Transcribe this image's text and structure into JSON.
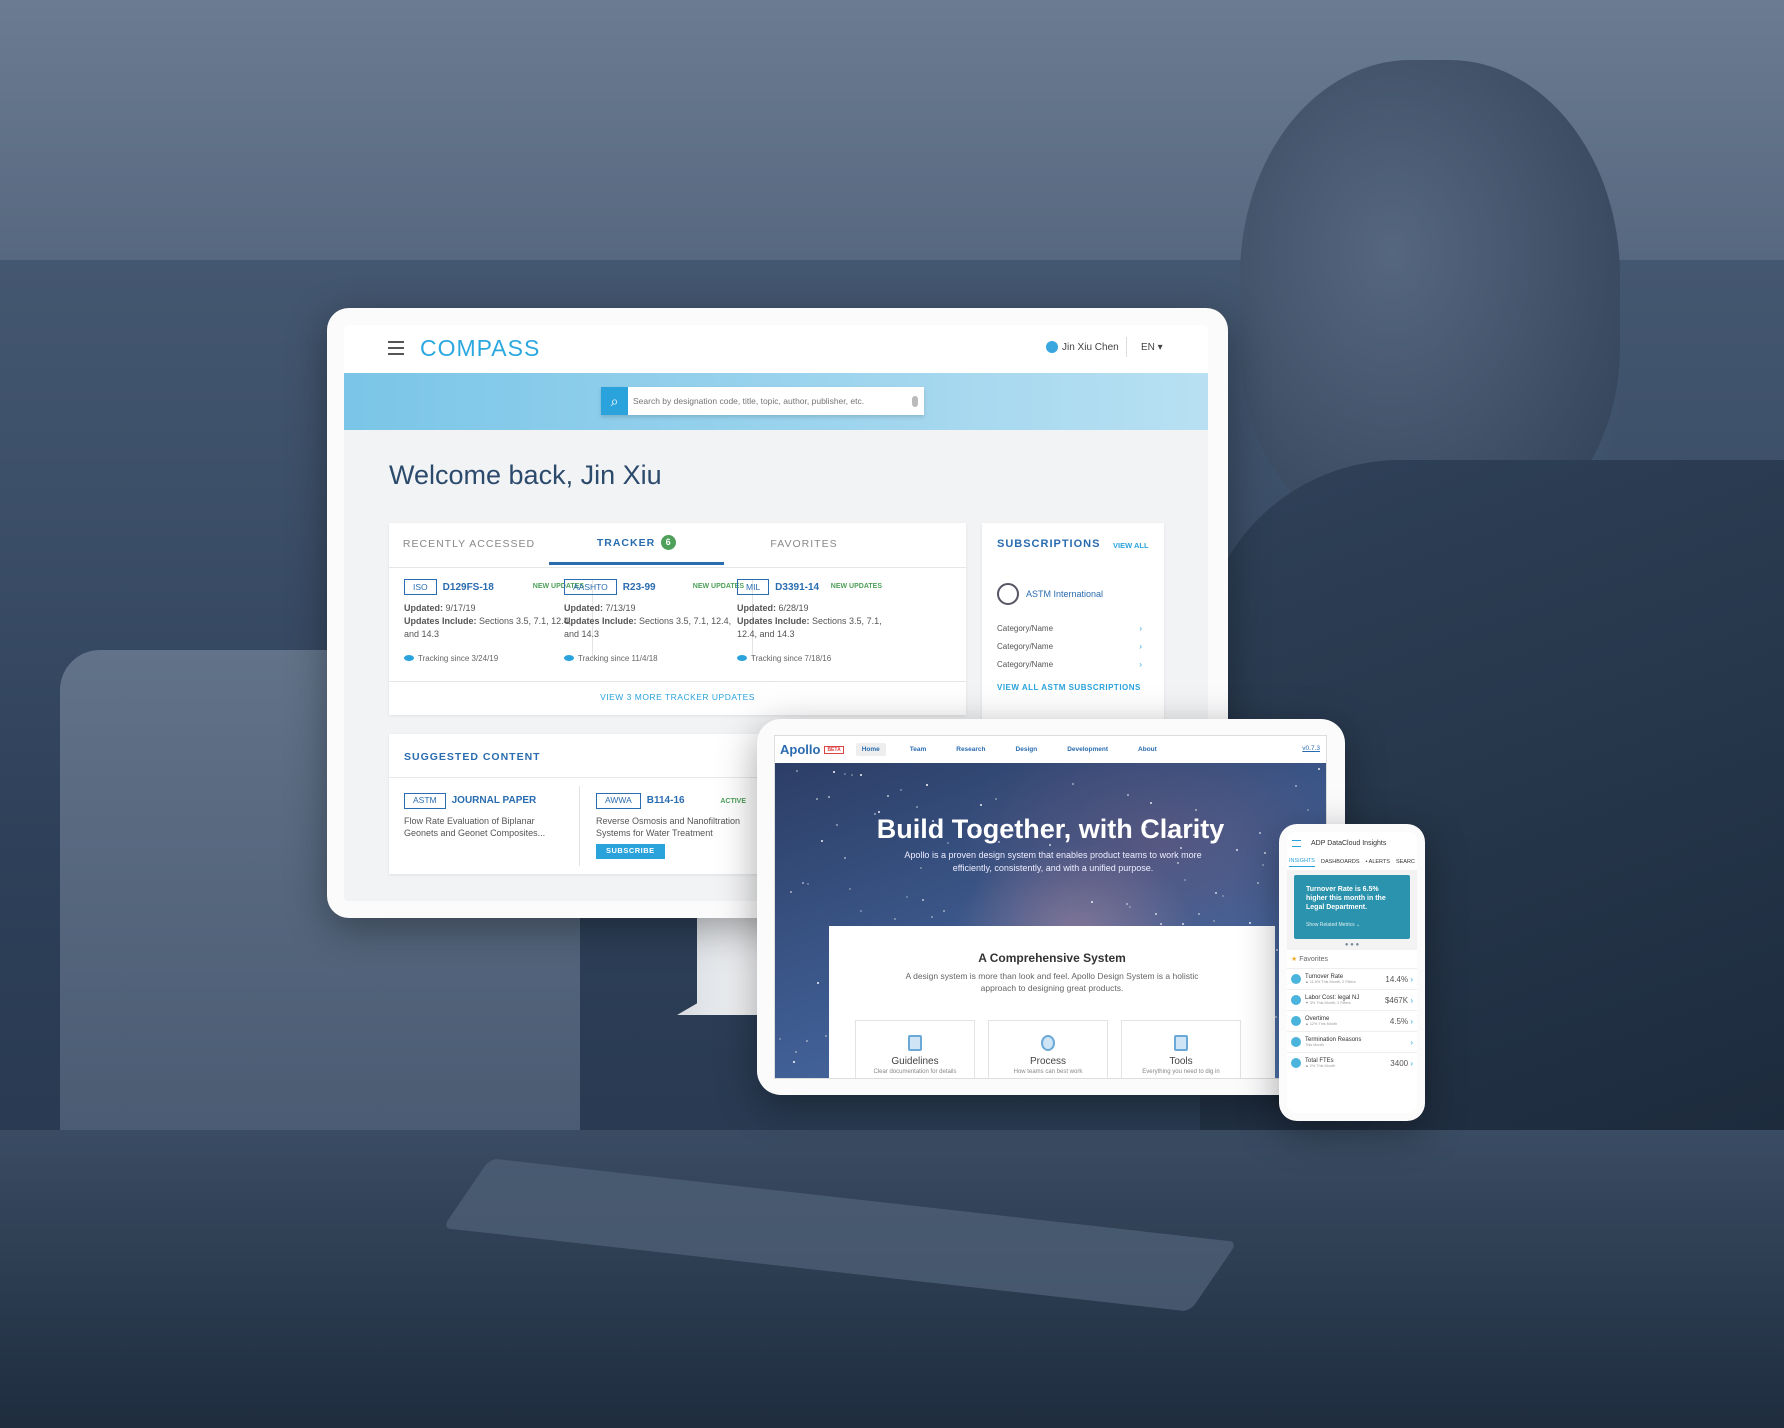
{
  "compass": {
    "logo": "COMPASS",
    "user": "Jin Xiu Chen",
    "language": "EN ▾",
    "search_placeholder": "Search by designation code, title, topic, author, publisher, etc.",
    "welcome": "Welcome back, Jin Xiu",
    "tabs": [
      {
        "label": "RECENTLY ACCESSED"
      },
      {
        "label": "TRACKER",
        "badge": "6"
      },
      {
        "label": "FAVORITES"
      }
    ],
    "tracker_items": [
      {
        "org": "ISO",
        "designation": "D129FS-18",
        "status": "NEW UPDATES",
        "updated_label": "Updated:",
        "updated": "9/17/19",
        "includes_label": "Updates Include:",
        "includes": "Sections 3.5, 7.1, 12.4, and 14.3",
        "tracking": "Tracking since 3/24/19"
      },
      {
        "org": "AASHTO",
        "designation": "R23-99",
        "status": "NEW UPDATES",
        "updated_label": "Updated:",
        "updated": "7/13/19",
        "includes_label": "Updates Include:",
        "includes": "Sections 3.5, 7.1, 12.4, and 14.3",
        "tracking": "Tracking since 11/4/18"
      },
      {
        "org": "MIL",
        "designation": "D3391-14",
        "status": "NEW UPDATES",
        "updated_label": "Updated:",
        "updated": "6/28/19",
        "includes_label": "Updates Include:",
        "includes": "Sections 3.5, 7.1, 12.4, and 14.3",
        "tracking": "Tracking since 7/18/16"
      }
    ],
    "view_more": "VIEW 3 MORE TRACKER UPDATES",
    "subscriptions": {
      "title": "SUBSCRIPTIONS",
      "view_all": "VIEW ALL",
      "org": "ASTM International",
      "categories": [
        "Category/Name",
        "Category/Name",
        "Category/Name"
      ],
      "view_all_org": "VIEW ALL ASTM SUBSCRIPTIONS"
    },
    "suggested": {
      "title": "SUGGESTED CONTENT",
      "items": [
        {
          "org": "ASTM",
          "designation": "JOURNAL PAPER",
          "status": "",
          "text": "Flow Rate Evaluation of Biplanar Geonets and Geonet Composites..."
        },
        {
          "org": "AWWA",
          "designation": "B114-16",
          "status": "ACTIVE",
          "text": "Reverse Osmosis and Nanofiltration Systems for Water Treatment",
          "button": "SUBSCRIBE"
        }
      ]
    }
  },
  "apollo": {
    "logo": "Apollo",
    "logo_sub": "Design System",
    "beta": "BETA",
    "nav": [
      "Home",
      "Team",
      "Research",
      "Design",
      "Development",
      "About"
    ],
    "version": "v0.7.3",
    "hero_title": "Build Together, with Clarity",
    "hero_subtitle": "Apollo is a proven design system that enables product teams to work more efficiently, consistently, and with a unified purpose.",
    "section_title": "A Comprehensive System",
    "section_text": "A design system is more than look and feel. Apollo Design System is a holistic approach to designing great products.",
    "features": [
      {
        "title": "Guidelines",
        "text": "Clear documentation for details"
      },
      {
        "title": "Process",
        "text": "How teams can best work"
      },
      {
        "title": "Tools",
        "text": "Everything you need to dig in"
      }
    ]
  },
  "adp": {
    "title": "ADP DataCloud Insights",
    "tabs": [
      "INSIGHTS",
      "DASHBOARDS",
      "• ALERTS",
      "SEARC"
    ],
    "insight": "Turnover Rate is 6.5% higher this month in the Legal Department.",
    "insight_link": "Show Related Metrics ⌄",
    "favorites": "Favorites",
    "rows": [
      {
        "name": "Turnover Rate",
        "sub": "▲ 11.6% This Month, 2 Filters",
        "value": "14.4%"
      },
      {
        "name": "Labor Cost: legal NJ",
        "sub": "▼ 3% This Month, 2 Filters",
        "value": "$467K"
      },
      {
        "name": "Overtime",
        "sub": "▲ 12% This Month",
        "value": "4.5%"
      },
      {
        "name": "Termination Reasons",
        "sub": "This Month",
        "value": ""
      },
      {
        "name": "Total FTEs",
        "sub": "▲ 2% This Month",
        "value": "3400"
      }
    ]
  },
  "colors": {
    "compass_blue": "#2a6cb0",
    "accent": "#2aa3dc",
    "green": "#4ea05a",
    "adp_teal": "#2b93ad"
  }
}
